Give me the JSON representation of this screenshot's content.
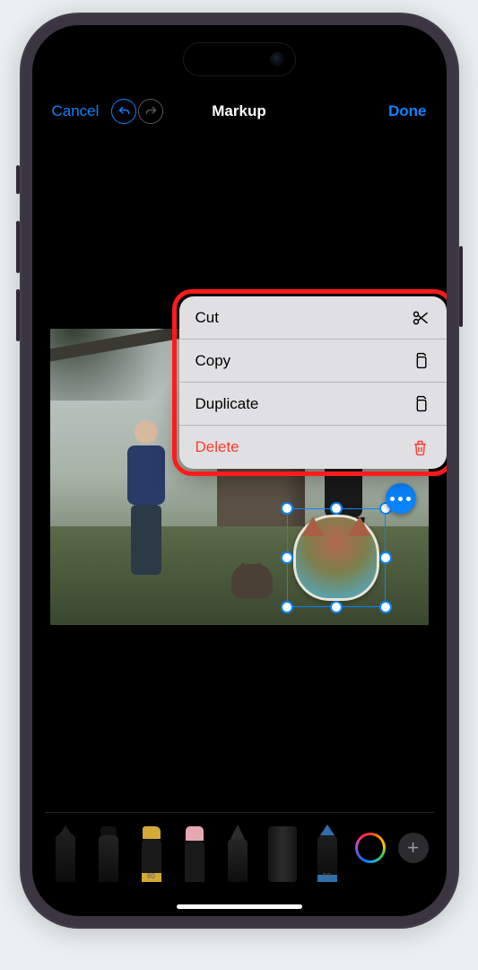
{
  "nav": {
    "cancel": "Cancel",
    "title": "Markup",
    "done": "Done"
  },
  "context_menu": {
    "cut": "Cut",
    "copy": "Copy",
    "duplicate": "Duplicate",
    "delete": "Delete"
  },
  "tools": {
    "highlighter_size": "80",
    "bluepencil_size": "50"
  },
  "icons": {
    "undo": "undo-icon",
    "redo": "redo-icon",
    "scissors": "scissors-icon",
    "docs": "documents-icon",
    "trash": "trash-icon",
    "more": "more-icon",
    "plus": "+"
  }
}
